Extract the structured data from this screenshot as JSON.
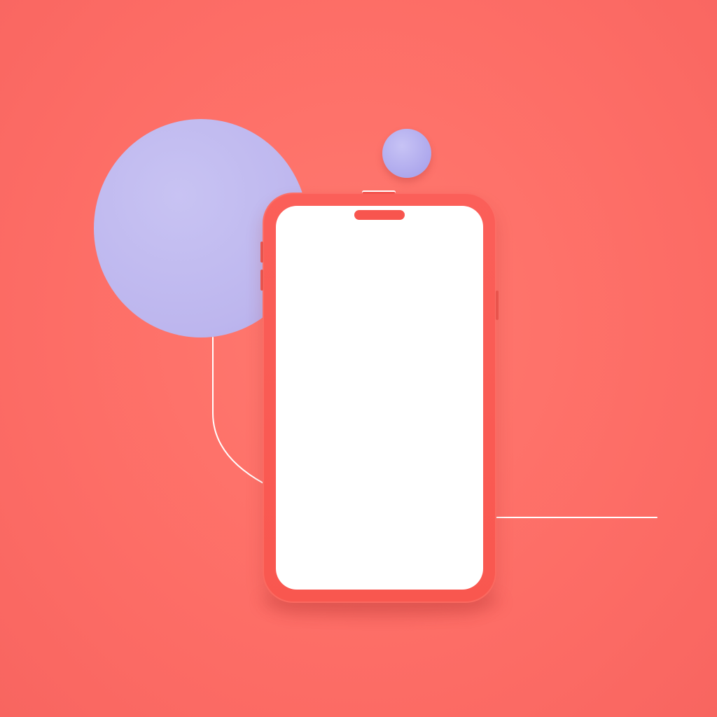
{
  "colors": {
    "background": "#fd6d66",
    "phone_body": "#f9574f",
    "screen": "#ffffff",
    "accent_circle": "#bdb6ee",
    "accent_sphere": "#aca6ec",
    "line": "#ffffff"
  },
  "scene": {
    "shapes": [
      "large-lavender-circle",
      "small-lavender-sphere",
      "smartphone-mockup",
      "thin-curved-line",
      "thin-horizontal-line"
    ]
  }
}
